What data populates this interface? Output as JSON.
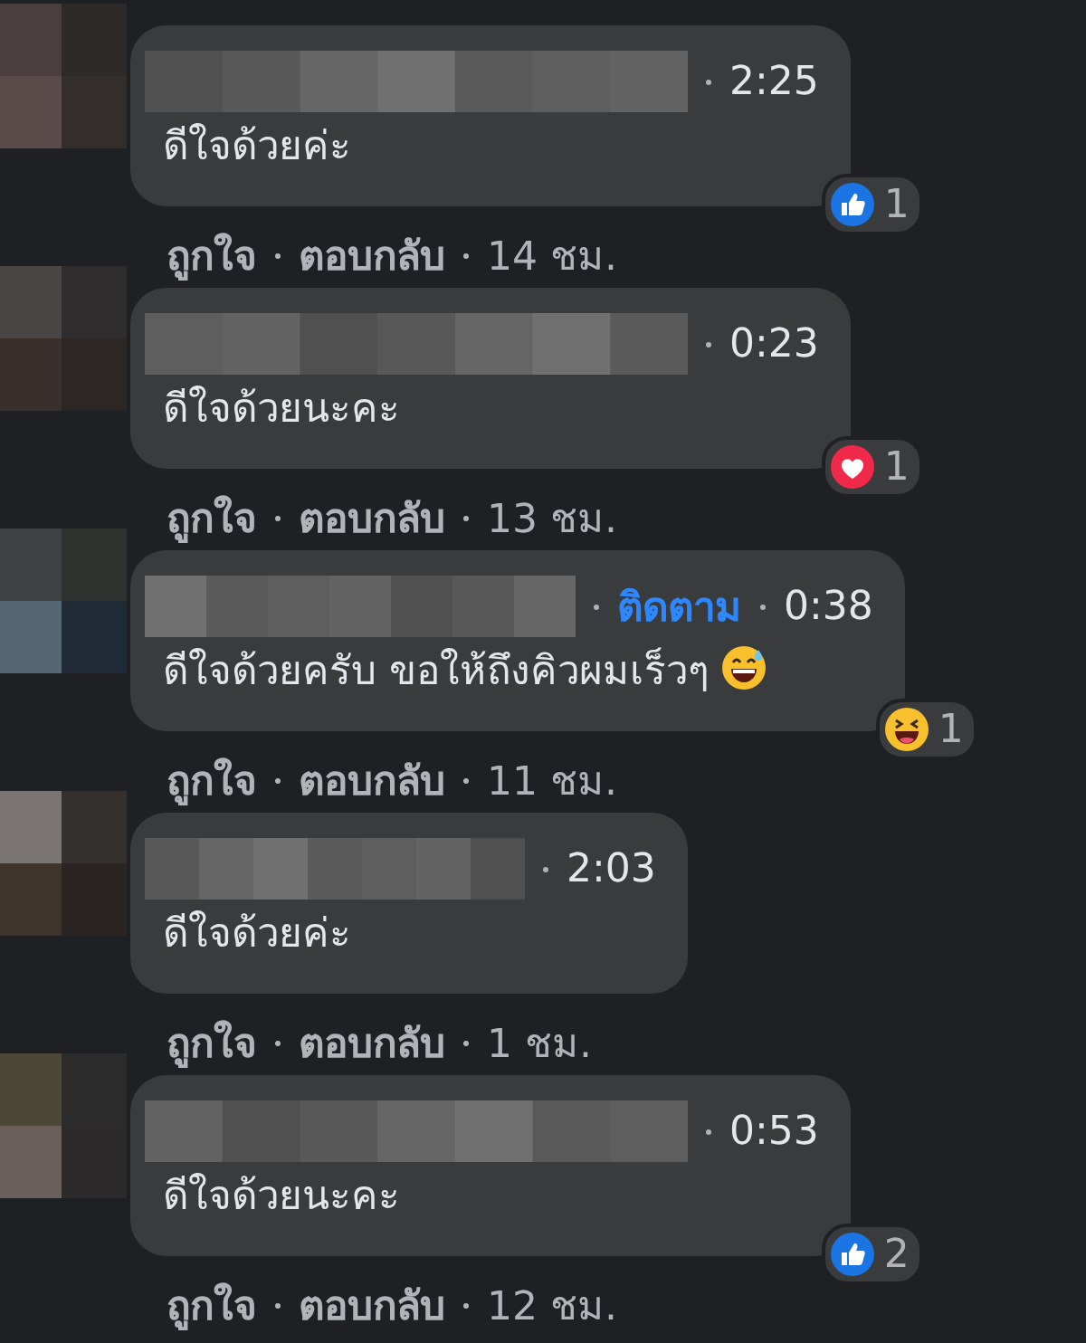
{
  "comments": [
    {
      "time": "2:25",
      "text": "ดีใจด้วยค่ะ",
      "reaction": {
        "kind": "like",
        "count": "1"
      },
      "actions": {
        "like": "ถูกใจ",
        "reply": "ตอบกลับ",
        "age": "14 ชม."
      }
    },
    {
      "time": "0:23",
      "text": "ดีใจด้วยนะคะ",
      "reaction": {
        "kind": "love",
        "count": "1"
      },
      "actions": {
        "like": "ถูกใจ",
        "reply": "ตอบกลับ",
        "age": "13 ชม."
      }
    },
    {
      "follow": "ติดตาม",
      "time": "0:38",
      "text": "ดีใจด้วยครับ ขอให้ถึงคิวผมเร็วๆ",
      "emoji": {
        "kind": "grin-sweat"
      },
      "reaction": {
        "kind": "haha",
        "count": "1"
      },
      "actions": {
        "like": "ถูกใจ",
        "reply": "ตอบกลับ",
        "age": "11 ชม."
      }
    },
    {
      "time": "2:03",
      "text": "ดีใจด้วยค่ะ",
      "actions": {
        "like": "ถูกใจ",
        "reply": "ตอบกลับ",
        "age": "1 ชม."
      }
    },
    {
      "time": "0:53",
      "text": "ดีใจด้วยนะคะ",
      "reaction": {
        "kind": "like",
        "count": "2"
      },
      "actions": {
        "like": "ถูกใจ",
        "reply": "ตอบกลับ",
        "age": "12 ชม."
      }
    }
  ]
}
